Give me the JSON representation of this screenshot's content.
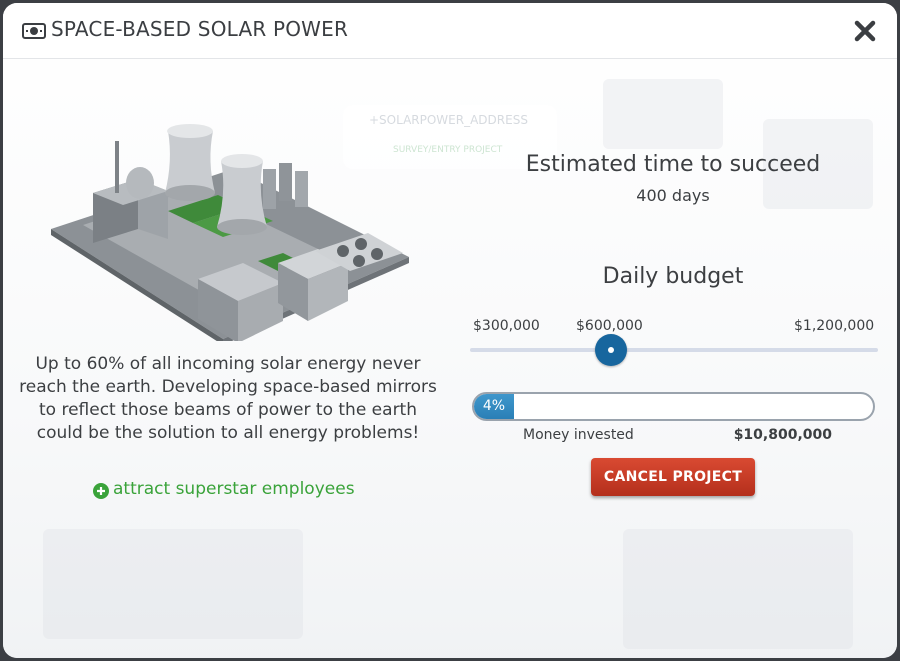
{
  "dialog": {
    "title": "SPACE-BASED SOLAR POWER",
    "title_icon": "money-icon",
    "close_icon": "close-icon"
  },
  "background": {
    "card_address": "+SOLARPOWER_ADDRESS",
    "card_link": "SURVEY/ENTRY PROJECT"
  },
  "project": {
    "illustration": "power-plant-illustration",
    "description": "Up to 60% of all incoming solar energy never reach the earth. Developing space-based mirrors to reflect those beams of power to the earth could be the solution to all energy problems!",
    "perk": {
      "icon": "plus-circle-icon",
      "label": "attract superstar employees",
      "color": "#3aa33a"
    }
  },
  "estimate": {
    "title": "Estimated time to succeed",
    "value": "400 days"
  },
  "budget": {
    "title": "Daily budget",
    "ticks": [
      "$300,000",
      "$600,000",
      "$1,200,000"
    ],
    "selected_value": 600000,
    "accent_color": "#17669e"
  },
  "progress": {
    "percent": 4,
    "label": "4%",
    "money_label": "Money invested",
    "money_value": "$10,800,000"
  },
  "actions": {
    "cancel_label": "CANCEL PROJECT",
    "cancel_color": "#c43b25"
  }
}
